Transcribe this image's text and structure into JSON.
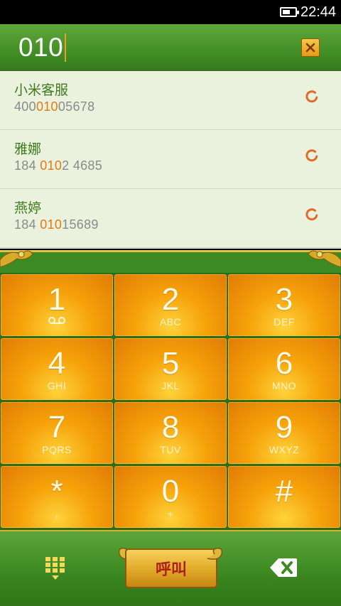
{
  "status_bar": {
    "time": "22:44",
    "battery_level": 0.6
  },
  "dialer": {
    "input_value": "010",
    "clear_icon": "close-icon"
  },
  "results": [
    {
      "name": "小米客服",
      "number_parts": [
        "400",
        "010",
        "05678"
      ]
    },
    {
      "name": "雅娜",
      "number_parts": [
        "184 ",
        "010",
        "2 4685"
      ]
    },
    {
      "name": "燕婷",
      "number_parts": [
        "184 ",
        "010",
        "15689"
      ]
    }
  ],
  "keypad": {
    "keys": [
      {
        "digit": "1",
        "letters": ""
      },
      {
        "digit": "2",
        "letters": "ABC"
      },
      {
        "digit": "3",
        "letters": "DEF"
      },
      {
        "digit": "4",
        "letters": "GHI"
      },
      {
        "digit": "5",
        "letters": "JKL"
      },
      {
        "digit": "6",
        "letters": "MNO"
      },
      {
        "digit": "7",
        "letters": "PQRS"
      },
      {
        "digit": "8",
        "letters": "TUV"
      },
      {
        "digit": "9",
        "letters": "WXYZ"
      },
      {
        "digit": "*",
        "letters": ","
      },
      {
        "digit": "0",
        "letters": "+"
      },
      {
        "digit": "#",
        "letters": ""
      }
    ]
  },
  "bottom_bar": {
    "call_label": "呼叫",
    "dialpad_icon": "dialpad-icon",
    "backspace_icon": "backspace-icon"
  },
  "colors": {
    "accent_green": "#3f8a24",
    "highlight_orange": "#e07b12",
    "key_orange": "#f6a20a",
    "call_red": "#b0201a"
  }
}
